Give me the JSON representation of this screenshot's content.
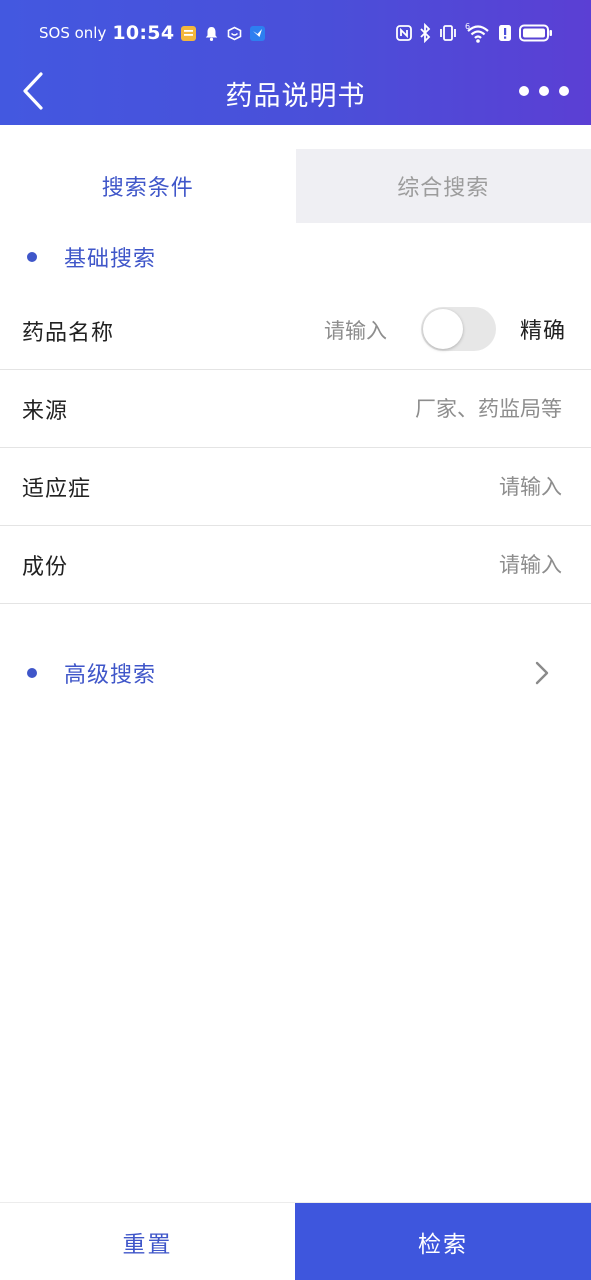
{
  "status_bar": {
    "carrier": "SOS only",
    "time": "10:54",
    "network": "6"
  },
  "nav": {
    "title": "药品说明书"
  },
  "tabs": [
    {
      "label": "搜索条件",
      "active": true
    },
    {
      "label": "综合搜索",
      "active": false
    }
  ],
  "basic_search": {
    "title": "基础搜索",
    "rows": [
      {
        "label": "药品名称",
        "placeholder": "请输入",
        "value": ""
      },
      {
        "label": "来源",
        "placeholder": "厂家、药监局等",
        "value": ""
      },
      {
        "label": "适应症",
        "placeholder": "请输入",
        "value": ""
      },
      {
        "label": "成份",
        "placeholder": "请输入",
        "value": ""
      }
    ],
    "exact_toggle": {
      "label": "精确",
      "on": false
    }
  },
  "advanced_search": {
    "title": "高级搜索"
  },
  "actions": {
    "reset_label": "重置",
    "search_label": "检索"
  },
  "colors": {
    "header_start": "#4358e0",
    "header_end": "#5b3fd4",
    "accent": "#3f56c9",
    "search_button": "#3e56dd",
    "inactive_tab_bg": "#efeff3"
  }
}
